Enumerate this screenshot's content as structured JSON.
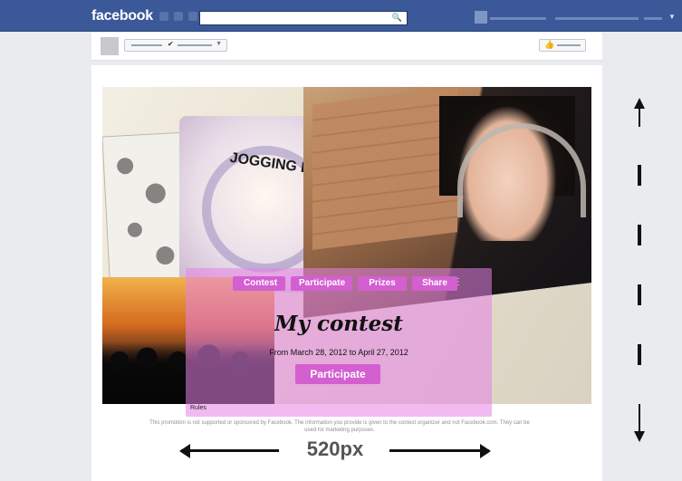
{
  "topbar": {
    "logo": "facebook",
    "search_placeholder": "",
    "search_icon": "magnifier-icon",
    "jewel_icons": [
      "friend-requests-icon",
      "messages-icon",
      "notifications-icon"
    ]
  },
  "page_header": {
    "like_icon": "thumbs-up-icon",
    "check_icon": "check-icon",
    "dropdown_icon": "chevron-down-icon"
  },
  "app": {
    "tabs": [
      "Contest",
      "Participate",
      "Prizes",
      "Share"
    ],
    "more_icon": "more-icon",
    "title": "My contest",
    "dates": "From March 28, 2012 to April 27, 2012",
    "cta_label": "Participate",
    "rules_link": "Rules",
    "disclaimer": "This promotion is not supported or sponsored by Facebook. The information you provide is given to the contest organizer and not Facebook.com. They can be used for marketing purposes.",
    "art_graffiti_text": "JOGGING DEATH S"
  },
  "annotations": {
    "width_label": "520px",
    "arrow_left_icon": "arrow-left-icon",
    "arrow_right_icon": "arrow-right-icon",
    "arrow_up_icon": "arrow-up-icon",
    "arrow_down_icon": "arrow-down-icon"
  },
  "colors": {
    "facebook_blue": "#3b5998",
    "app_pink": "#d35fd0",
    "panel_pink": "#e682e6",
    "page_bg": "#e9ebee"
  }
}
